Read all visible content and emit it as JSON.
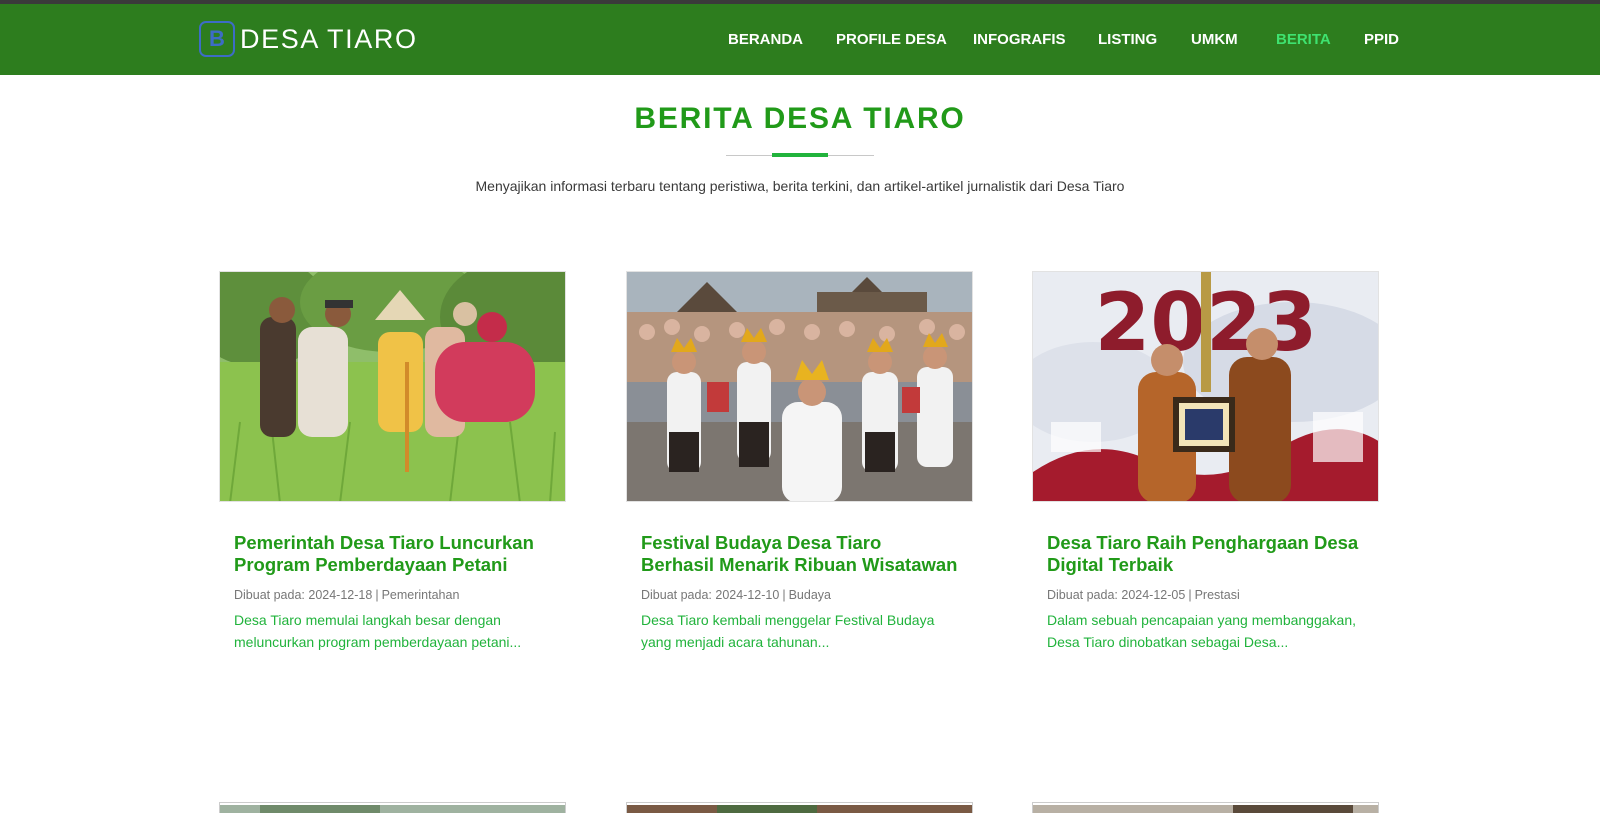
{
  "brand": {
    "logo_letter": "B",
    "name": "DESA TIARO"
  },
  "nav": [
    {
      "label": "BERANDA",
      "active": false
    },
    {
      "label": "PROFILE DESA",
      "active": false
    },
    {
      "label": "INFOGRAFIS",
      "active": false
    },
    {
      "label": "LISTING",
      "active": false
    },
    {
      "label": "UMKM",
      "active": false
    },
    {
      "label": "BERITA",
      "active": true
    },
    {
      "label": "PPID",
      "active": false
    }
  ],
  "page": {
    "title": "BERITA DESA TIARO",
    "subtitle": "Menyajikan informasi terbaru tentang peristiwa, berita terkini, dan artikel-artikel jurnalistik dari Desa Tiaro"
  },
  "articles": [
    {
      "title": "Pemerintah Desa Tiaro Luncurkan Program Pemberdayaan Petani",
      "meta_prefix": "Dibuat pada:",
      "date": "2024-12-18",
      "category": "Pemerintahan",
      "excerpt": "Desa Tiaro memulai langkah besar dengan meluncurkan program pemberdayaan petani...",
      "image": "farmers-in-rice-field-photo"
    },
    {
      "title": "Festival Budaya Desa Tiaro Berhasil Menarik Ribuan Wisatawan",
      "meta_prefix": "Dibuat pada:",
      "date": "2024-12-10",
      "category": "Budaya",
      "excerpt": "Desa Tiaro kembali menggelar Festival Budaya yang menjadi acara tahunan...",
      "image": "balinese-dancers-festival-photo"
    },
    {
      "title": "Desa Tiaro Raih Penghargaan Desa Digital Terbaik",
      "meta_prefix": "Dibuat pada:",
      "date": "2024-12-05",
      "category": "Prestasi",
      "excerpt": "Dalam sebuah pencapaian yang membanggakan, Desa Tiaro dinobatkan sebagai Desa...",
      "image": "award-ceremony-2023-photo",
      "banner_text": "2023"
    }
  ],
  "colors": {
    "navbar": "#2d7d1e",
    "nav_active": "#3ee26f",
    "title": "#219a19",
    "excerpt": "#21b33c"
  }
}
